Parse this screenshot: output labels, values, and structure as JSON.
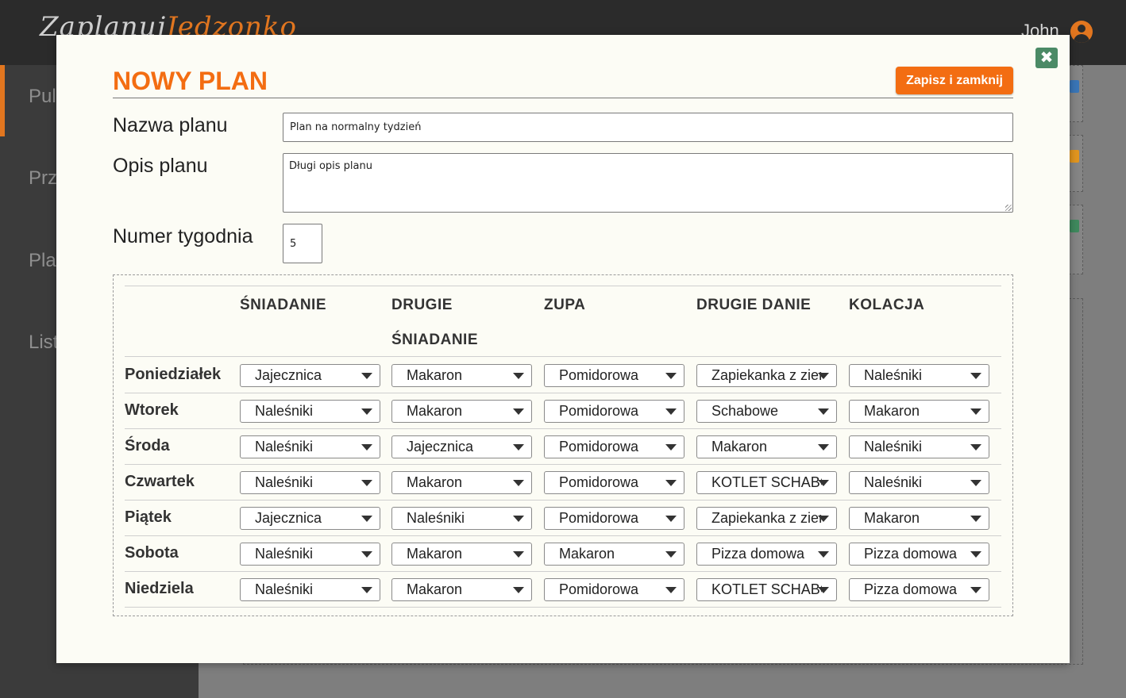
{
  "app": {
    "logo_part1": "Zaplanuj",
    "logo_part2": "Jedzonko",
    "user_name": "John",
    "sidebar_items": [
      "Pulpit",
      "Przepisy",
      "Plany",
      "Lista"
    ]
  },
  "modal": {
    "title": "NOWY PLAN",
    "save_label": "Zapisz i zamknij",
    "close_glyph": "✖",
    "name_label": "Nazwa planu",
    "name_value": "Plan na normalny tydzień",
    "desc_label": "Opis planu",
    "desc_value": "Długi opis planu",
    "week_label": "Numer tygodnia",
    "week_value": "5"
  },
  "plan_table": {
    "columns": [
      "ŚNIADANIE",
      "DRUGIE",
      "ŚNIADANIE",
      "ZUPA",
      "DRUGIE DANIE",
      "KOLACJA"
    ],
    "days": [
      "Poniedziałek",
      "Wtorek",
      "Środa",
      "Czwartek",
      "Piątek",
      "Sobota",
      "Niedziela"
    ],
    "rows": [
      [
        "Jajecznica",
        "Makaron",
        "Pomidorowa",
        "Zapiekanka z ziemniakami",
        "Naleśniki"
      ],
      [
        "Naleśniki",
        "Makaron",
        "Pomidorowa",
        "Schabowe",
        "Makaron"
      ],
      [
        "Naleśniki",
        "Jajecznica",
        "Pomidorowa",
        "Makaron",
        "Naleśniki"
      ],
      [
        "Naleśniki",
        "Makaron",
        "Pomidorowa",
        "KOTLET SCHABOWY",
        "Naleśniki"
      ],
      [
        "Jajecznica",
        "Naleśniki",
        "Pomidorowa",
        "Zapiekanka z ziemniakami",
        "Makaron"
      ],
      [
        "Naleśniki",
        "Makaron",
        "Makaron",
        "Pizza domowa",
        "Pizza domowa"
      ],
      [
        "Naleśniki",
        "Makaron",
        "Pomidorowa",
        "KOTLET SCHABOWY",
        "Pizza domowa"
      ]
    ]
  },
  "colors": {
    "accent": "#f36d12",
    "close_button": "#4b8a66",
    "modal_bg": "#fcfcf5",
    "topbar": "#2b2b2b",
    "sidebar": "#3b3b3b",
    "card_tags": [
      "#3a76b8",
      "#e2961f",
      "#3f8a5e"
    ]
  }
}
